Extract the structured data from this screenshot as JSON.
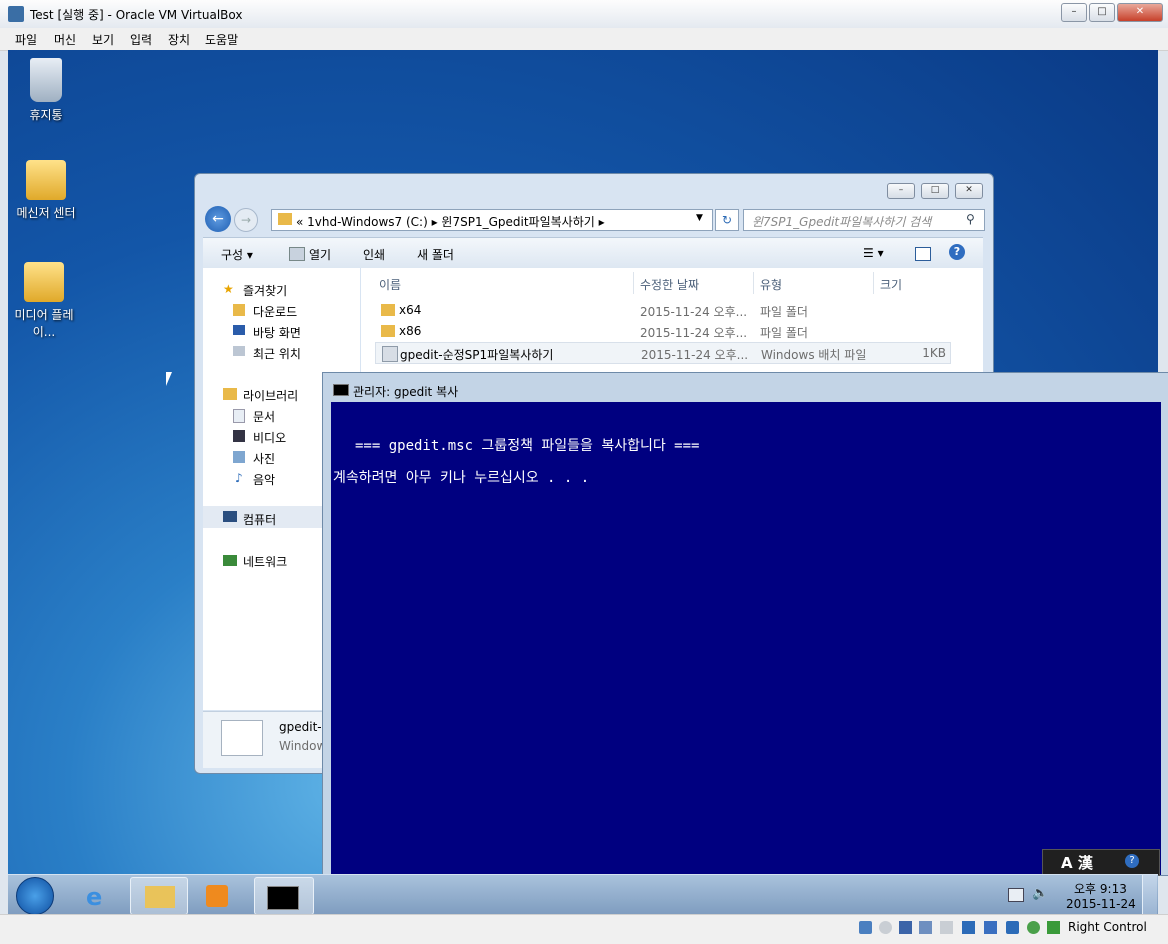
{
  "host": {
    "title": "Test [실행 중] - Oracle VM VirtualBox",
    "menu": [
      "파일",
      "머신",
      "보기",
      "입력",
      "장치",
      "도움말"
    ],
    "status_right": "Right Control"
  },
  "desktop_icons": [
    {
      "label": "휴지통",
      "icon": "recycle-bin-icon"
    },
    {
      "label": "메신저 센터",
      "icon": "messenger-icon"
    },
    {
      "label": "미디어 플레이...",
      "icon": "media-player-icon"
    }
  ],
  "explorer": {
    "address": "« 1vhd-Windows7 (C:) ▸ 윈7SP1_Gpedit파일복사하기 ▸",
    "search_placeholder": "윈7SP1_Gpedit파일복사하기 검색",
    "toolbar": [
      "구성 ▾",
      "열기",
      "인쇄",
      "새 폴더"
    ],
    "nav": {
      "favorites": "즐겨찾기",
      "fav_items": [
        "다운로드",
        "바탕 화면",
        "최근 위치"
      ],
      "libraries": "라이브러리",
      "lib_items": [
        "문서",
        "비디오",
        "사진",
        "음악"
      ],
      "computer": "컴퓨터",
      "network": "네트워크"
    },
    "columns": [
      "이름",
      "수정한 날짜",
      "유형",
      "크기"
    ],
    "files": [
      {
        "name": "x64",
        "date": "2015-11-24 오후...",
        "type": "파일 폴더",
        "size": ""
      },
      {
        "name": "x86",
        "date": "2015-11-24 오후...",
        "type": "파일 폴더",
        "size": ""
      },
      {
        "name": "gpedit-순정SP1파일복사하기",
        "date": "2015-11-24 오후...",
        "type": "Windows 배치 파일",
        "size": "1KB"
      }
    ],
    "details": {
      "name": "gpedit-",
      "type": "Window"
    }
  },
  "console": {
    "title": "관리자:  gpedit 복사",
    "line1": "=== gpedit.msc 그룹정책 파일들을 복사합니다 ===",
    "line2": "계속하려면 아무 키나 누르십시오 . . ."
  },
  "tray": {
    "ime": "A 漢",
    "time": "오후 9:13",
    "date": "2015-11-24"
  }
}
